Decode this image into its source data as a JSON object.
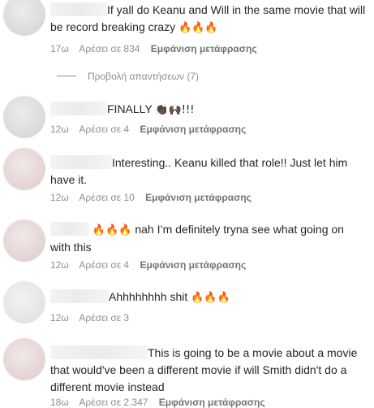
{
  "comments": [
    {
      "text": "If yall do Keanu and Will in the same movie that will be record breaking crazy",
      "emoji": "🔥🔥🔥",
      "time": "17ω",
      "likes": "Αρέσει σε 834",
      "translate": "Εμφάνιση μετάφρασης"
    },
    {
      "text": "FINALLY",
      "emoji": "👏🏿🙌🏿!!!",
      "time": "12ω",
      "likes": "Αρέσει σε 4",
      "translate": "Εμφάνιση μετάφρασης"
    },
    {
      "text": "Interesting.. Keanu killed that role!! Just let him have it.",
      "time": "12ω",
      "likes": "Αρέσει σε 10",
      "translate": "Εμφάνιση μετάφρασης"
    },
    {
      "emoji": "🔥🔥🔥",
      "text": "nah I’m definitely tryna see what going on with this",
      "time": "12ω",
      "likes": "Αρέσει σε 4",
      "translate": "Εμφάνιση μετάφρασης"
    },
    {
      "text": "Ahhhhhhhh shit",
      "emoji": "🔥🔥🔥",
      "time": "12ω",
      "likes": "Αρέσει σε 3"
    },
    {
      "text": "This is going to be a movie about a movie that would've been a different movie if will Smith didn't do a different movie instead",
      "time": "18ω",
      "likes": "Αρέσει σε 2.347",
      "translate": "Εμφάνιση μετάφρασης"
    }
  ],
  "view_replies": "Προβολή απαντήσεων (7)"
}
